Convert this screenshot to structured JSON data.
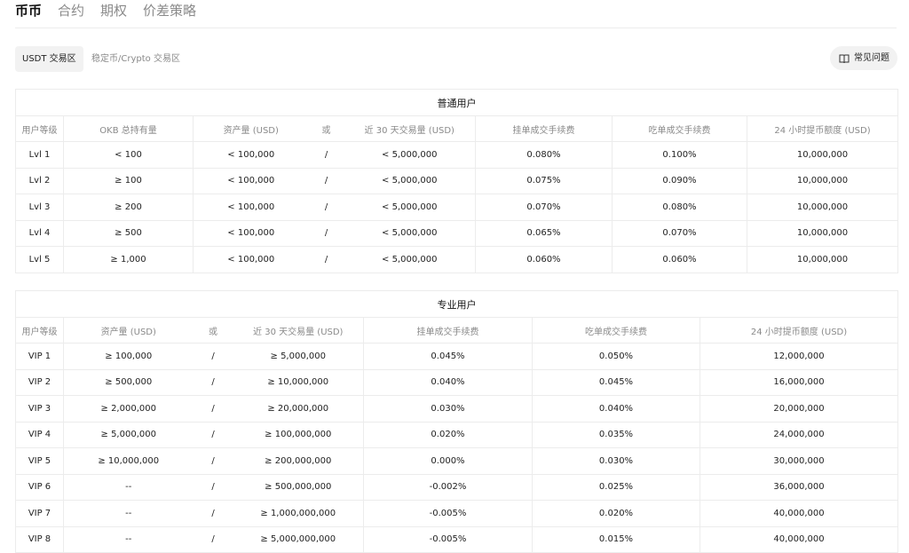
{
  "tabs": [
    {
      "label": "币币",
      "active": true
    },
    {
      "label": "合约",
      "active": false
    },
    {
      "label": "期权",
      "active": false
    },
    {
      "label": "价差策略",
      "active": false
    }
  ],
  "segments": [
    {
      "label": "USDT 交易区",
      "active": true
    },
    {
      "label": "稳定币/Crypto 交易区",
      "active": false
    }
  ],
  "faq": {
    "label": "常见问题",
    "icon": "book-icon"
  },
  "regular": {
    "title": "普通用户",
    "headers": [
      "用户等级",
      "OKB 总持有量",
      "资产量 (USD)",
      "或",
      "近 30 天交易量 (USD)",
      "挂单成交手续费",
      "吃单成交手续费",
      "24 小时提币额度 (USD)"
    ],
    "rows": [
      [
        "Lvl 1",
        "< 100",
        "< 100,000",
        "/",
        "< 5,000,000",
        "0.080%",
        "0.100%",
        "10,000,000"
      ],
      [
        "Lvl 2",
        "≥ 100",
        "< 100,000",
        "/",
        "< 5,000,000",
        "0.075%",
        "0.090%",
        "10,000,000"
      ],
      [
        "Lvl 3",
        "≥ 200",
        "< 100,000",
        "/",
        "< 5,000,000",
        "0.070%",
        "0.080%",
        "10,000,000"
      ],
      [
        "Lvl 4",
        "≥ 500",
        "< 100,000",
        "/",
        "< 5,000,000",
        "0.065%",
        "0.070%",
        "10,000,000"
      ],
      [
        "Lvl 5",
        "≥ 1,000",
        "< 100,000",
        "/",
        "< 5,000,000",
        "0.060%",
        "0.060%",
        "10,000,000"
      ]
    ]
  },
  "pro": {
    "title": "专业用户",
    "headers": [
      "用户等级",
      "资产量 (USD)",
      "或",
      "近 30 天交易量 (USD)",
      "挂单成交手续费",
      "吃单成交手续费",
      "24 小时提币额度 (USD)"
    ],
    "rows": [
      [
        "VIP 1",
        "≥ 100,000",
        "/",
        "≥ 5,000,000",
        "0.045%",
        "0.050%",
        "12,000,000"
      ],
      [
        "VIP 2",
        "≥ 500,000",
        "/",
        "≥ 10,000,000",
        "0.040%",
        "0.045%",
        "16,000,000"
      ],
      [
        "VIP 3",
        "≥ 2,000,000",
        "/",
        "≥ 20,000,000",
        "0.030%",
        "0.040%",
        "20,000,000"
      ],
      [
        "VIP 4",
        "≥ 5,000,000",
        "/",
        "≥ 100,000,000",
        "0.020%",
        "0.035%",
        "24,000,000"
      ],
      [
        "VIP 5",
        "≥ 10,000,000",
        "/",
        "≥ 200,000,000",
        "0.000%",
        "0.030%",
        "30,000,000"
      ],
      [
        "VIP 6",
        "--",
        "/",
        "≥ 500,000,000",
        "-0.002%",
        "0.025%",
        "36,000,000"
      ],
      [
        "VIP 7",
        "--",
        "/",
        "≥ 1,000,000,000",
        "-0.005%",
        "0.020%",
        "40,000,000"
      ],
      [
        "VIP 8",
        "--",
        "/",
        "≥ 5,000,000,000",
        "-0.005%",
        "0.015%",
        "40,000,000"
      ]
    ]
  }
}
